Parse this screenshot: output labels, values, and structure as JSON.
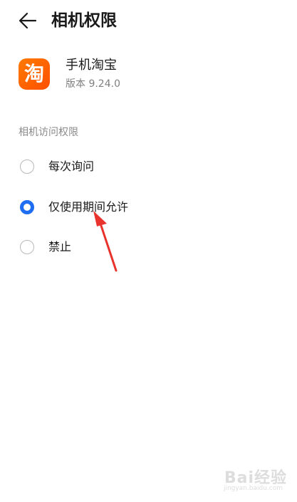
{
  "header": {
    "title": "相机权限",
    "back_icon": "arrow-left-icon"
  },
  "app": {
    "name": "手机淘宝",
    "version": "版本 9.24.0",
    "icon_char": "淘",
    "icon_color": "#ff5a00"
  },
  "permission": {
    "section_label": "相机访问权限",
    "options": [
      {
        "label": "每次询问",
        "selected": false
      },
      {
        "label": "仅使用期间允许",
        "selected": true
      },
      {
        "label": "禁止",
        "selected": false
      }
    ]
  },
  "colors": {
    "accent": "#1f6ef2",
    "annotation_arrow": "#e8342c"
  },
  "watermark": {
    "brand": "Bai经验",
    "url": "jingyan.baidu.com"
  }
}
